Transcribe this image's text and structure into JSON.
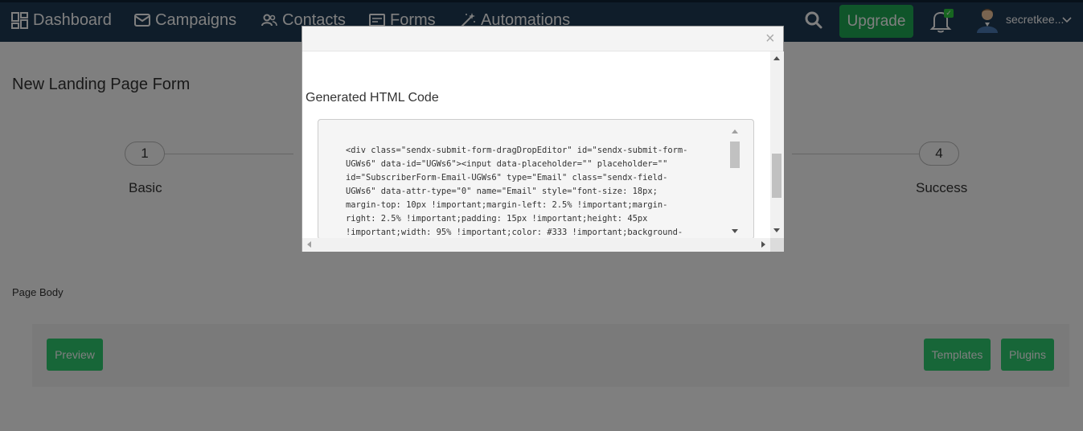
{
  "nav": {
    "dashboard": "Dashboard",
    "campaigns": "Campaigns",
    "contacts": "Contacts",
    "forms": "Forms",
    "automations": "Automations",
    "upgrade": "Upgrade",
    "username": "secretkee...",
    "notification_badge": "✓"
  },
  "page": {
    "title": "New Landing Page Form",
    "steps": [
      {
        "number": "1",
        "label": "Basic"
      },
      {
        "number": "4",
        "label": "Success"
      }
    ],
    "body_label": "Page Body",
    "buttons": {
      "preview": "Preview",
      "templates": "Templates",
      "plugins": "Plugins"
    }
  },
  "modal": {
    "close": "×",
    "heading": "Generated HTML Code",
    "code": "<div class=\"sendx-submit-form-dragDropEditor\" id=\"sendx-submit-form-\nUGWs6\" data-id=\"UGWs6\"><input data-placeholder=\"\" placeholder=\"\"\nid=\"SubscriberForm-Email-UGWs6\" type=\"Email\" class=\"sendx-field-\nUGWs6\" data-attr-type=\"0\" name=\"Email\" style=\"font-size: 18px;\nmargin-top: 10px !important;margin-left: 2.5% !important;margin-\nright: 2.5% !important;padding: 15px !important;height: 45px\n!important;width: 95% !important;color: #333 !important;background-"
  },
  "colors": {
    "nav_bg": "#1f3a54",
    "upgrade_green": "#1faa54",
    "editor_button_green": "#2ecc71",
    "overlay": "rgba(0,0,0,0.5)"
  },
  "icons": [
    "dashboard-icon",
    "mail-icon",
    "contacts-icon",
    "forms-icon",
    "magic-wand-icon",
    "search-icon",
    "bell-icon",
    "avatar",
    "chevron-down-icon",
    "close-icon"
  ]
}
